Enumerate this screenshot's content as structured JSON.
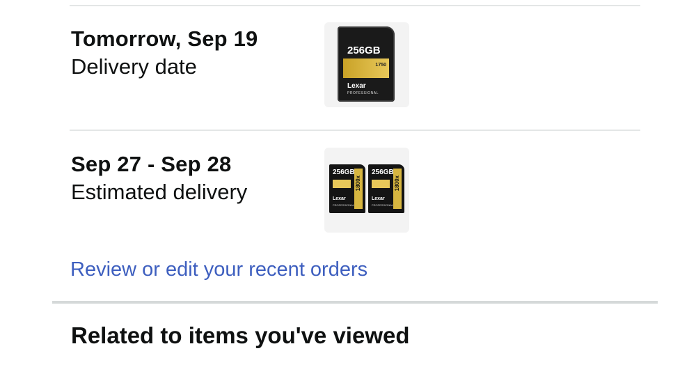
{
  "orders": [
    {
      "date": "Tomorrow, Sep 19",
      "status": "Delivery date",
      "product": {
        "icon": "cfexpress-card-icon",
        "capacity": "256GB",
        "speed": "1750",
        "brand": "Lexar",
        "line": "PROFESSIONAL",
        "colors": {
          "body": "#1a1a1a",
          "accent": "#c9a227"
        }
      }
    },
    {
      "date": "Sep 27 - Sep 28",
      "status": "Estimated delivery",
      "product": {
        "icon": "sd-card-pair-icon",
        "capacity": "256GB",
        "speed": "1800x",
        "brand": "Lexar",
        "line": "PROFESSIONAL",
        "colors": {
          "body": "#141414",
          "accent": "#d7b640"
        }
      }
    }
  ],
  "review_link": "Review or edit your recent orders",
  "related_title": "Related to items you've viewed",
  "colors": {
    "link": "#3e5fbf",
    "divider": "#e3e6e6",
    "text": "#0f1111"
  }
}
